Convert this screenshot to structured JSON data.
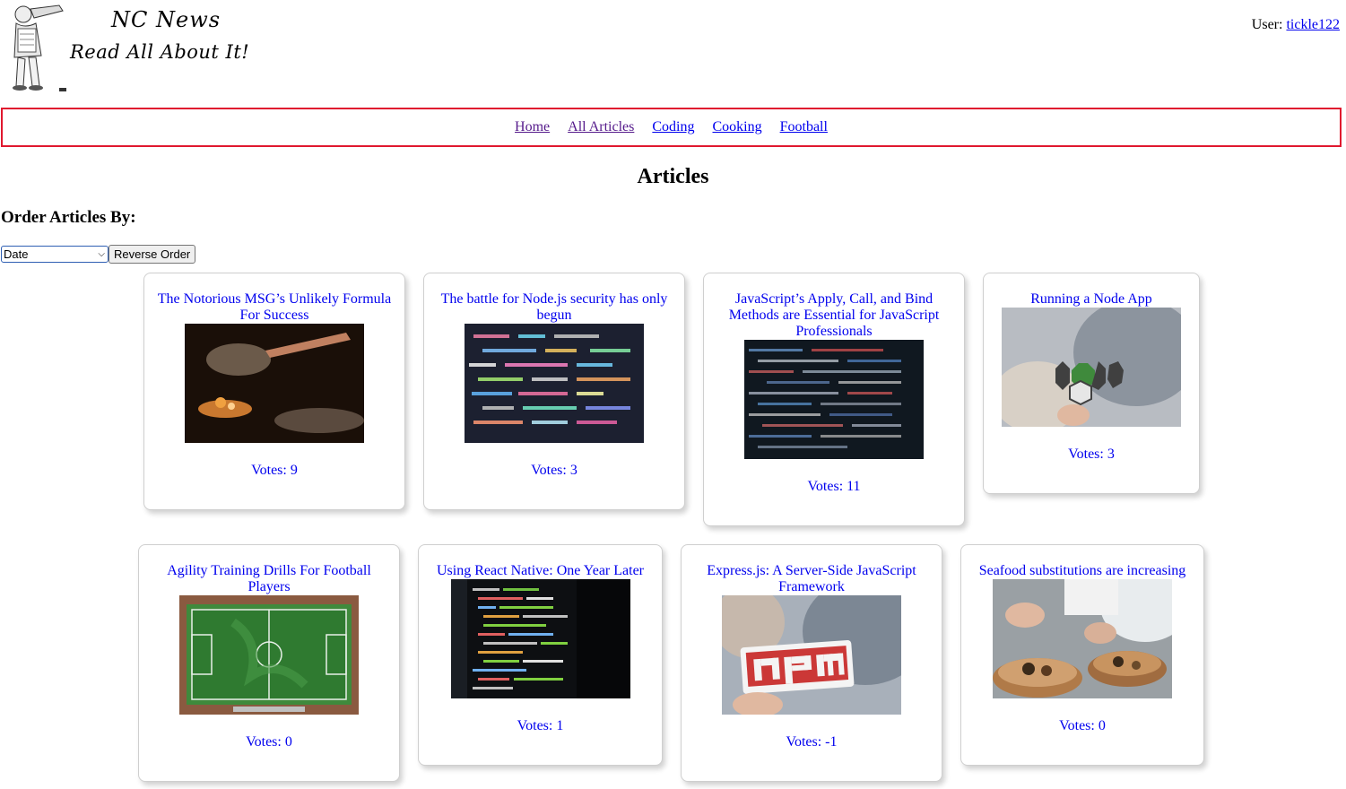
{
  "brand": {
    "title": "NC News",
    "tagline": "Read All About It!"
  },
  "user": {
    "label": "User:",
    "username": "tickle122"
  },
  "nav": {
    "links": [
      "Home",
      "All Articles",
      "Coding",
      "Cooking",
      "Football"
    ]
  },
  "page": {
    "title": "Articles",
    "order_heading": "Order Articles By:"
  },
  "controls": {
    "sort_value": "Date",
    "reverse_label": "Reverse Order"
  },
  "articles": [
    {
      "title": "The Notorious MSG’s Unlikely Formula For Success",
      "votes": "Votes: 9",
      "image": "cooking-pan-flames"
    },
    {
      "title": "The battle for Node.js security has only begun",
      "votes": "Votes: 3",
      "image": "code-screen-colorful"
    },
    {
      "title": "JavaScript’s Apply, Call, and Bind Methods are Essential for JavaScript Professionals",
      "votes": "Votes: 11",
      "image": "code-screen-dark"
    },
    {
      "title": "Running a Node App",
      "votes": "Votes: 3",
      "image": "nodejs-sticker"
    },
    {
      "title": "Agility Training Drills For Football Players",
      "votes": "Votes: 0",
      "image": "football-pitch-aerial"
    },
    {
      "title": "Using React Native: One Year Later",
      "votes": "Votes: 1",
      "image": "code-screen-green"
    },
    {
      "title": "Express.js: A Server-Side JavaScript Framework",
      "votes": "Votes: -1",
      "image": "npm-sticker"
    },
    {
      "title": "Seafood substitutions are increasing",
      "votes": "Votes: 0",
      "image": "seafood-plating"
    }
  ],
  "colors": {
    "link": "#0000ee",
    "visited": "#551a8b",
    "nav_border": "#e0182f"
  }
}
